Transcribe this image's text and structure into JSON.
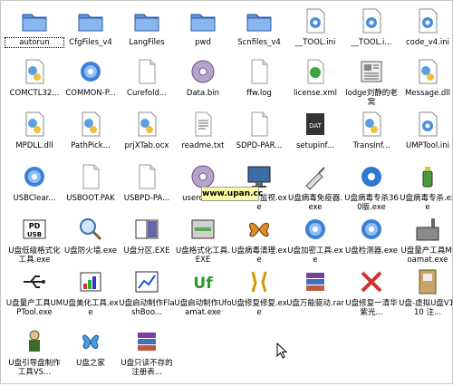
{
  "watermark": "www.upan.cc",
  "files": [
    {
      "label": "autorun",
      "icon": "folder-icon"
    },
    {
      "label": "CfgFiles_v4",
      "icon": "folder-icon"
    },
    {
      "label": "LangFiles",
      "icon": "folder-icon"
    },
    {
      "label": "pwd",
      "icon": "folder-icon"
    },
    {
      "label": "Scnfiles_v4",
      "icon": "folder-icon"
    },
    {
      "label": "__TOOL.ini",
      "icon": "settings-file-icon"
    },
    {
      "label": "__TOOL.i...",
      "icon": "settings-file-icon"
    },
    {
      "label": "code_v4.ini",
      "icon": "settings-file-icon"
    },
    {
      "label": "COMCTL32...",
      "icon": "dll-gear-icon"
    },
    {
      "label": "COMMON-P...",
      "icon": "gear-blue-icon"
    },
    {
      "label": "Curefold...",
      "icon": "document-icon"
    },
    {
      "label": "Data.bin",
      "icon": "disc-icon"
    },
    {
      "label": "ffw.log",
      "icon": "document-icon"
    },
    {
      "label": "license.xml",
      "icon": "xml-icon"
    },
    {
      "label": "lodge刘静的老窝",
      "icon": "newspaper-icon"
    },
    {
      "label": "Message.dll",
      "icon": "dll-gear-icon"
    },
    {
      "label": "MPDLL.dll",
      "icon": "dll-gear-icon"
    },
    {
      "label": "PathPick...",
      "icon": "dll-gear-icon"
    },
    {
      "label": "prjXTab.ocx",
      "icon": "dll-gear-icon"
    },
    {
      "label": "readme.txt",
      "icon": "text-file-icon"
    },
    {
      "label": "SDPD-PAR...",
      "icon": "document-icon"
    },
    {
      "label": "setupinf...",
      "icon": "dat-icon"
    },
    {
      "label": "TransInf...",
      "icon": "dll-gear-icon"
    },
    {
      "label": "UMPTool.ini",
      "icon": "settings-file-icon"
    },
    {
      "label": "USBClear...",
      "icon": "gear-blue-icon"
    },
    {
      "label": "USBOOT.PAK",
      "icon": "document-icon"
    },
    {
      "label": "USBPD-PA...",
      "icon": "document-icon"
    },
    {
      "label": "userdata...",
      "icon": "disc-icon"
    },
    {
      "label": "U盘病毒监视.exe",
      "icon": "monitor-icon"
    },
    {
      "label": "U盘病毒免疫器.exe",
      "icon": "syringe-icon"
    },
    {
      "label": "U盘病毒专杀360版.exe",
      "icon": "shield-gear-icon"
    },
    {
      "label": "U盘病毒专杀.exe",
      "icon": "bottle-icon"
    },
    {
      "label": "U盘低级格式化工具.exe",
      "icon": "usb-pd-icon"
    },
    {
      "label": "U盘防火墙.exe",
      "icon": "magnifier-icon"
    },
    {
      "label": "U盘分区.EXE",
      "icon": "partition-icon"
    },
    {
      "label": "U盘格式化工具.EXE",
      "icon": "format-tool-icon"
    },
    {
      "label": "U盘病毒清理.exe",
      "icon": "butterfly-icon"
    },
    {
      "label": "U盘加密工具.exe",
      "icon": "gear-blue-icon"
    },
    {
      "label": "U盘检测器.exe",
      "icon": "gear-blue-icon"
    },
    {
      "label": "U盘量产工具Mfoamat.exe",
      "icon": "factory-icon"
    },
    {
      "label": "U盘量产工具UMPTool.exe",
      "icon": "usb-symbol-icon"
    },
    {
      "label": "U盘美化工具.exe",
      "icon": "paint-icon"
    },
    {
      "label": "U盘启动制作FlashBoo...",
      "icon": "chart-window-icon"
    },
    {
      "label": "U盘启动制作Ufoamat.exe",
      "icon": "uf-logo-icon"
    },
    {
      "label": "U盘修复修复.exe",
      "icon": "tools-icon"
    },
    {
      "label": "U盘万能驱动.rar",
      "icon": "winrar-icon"
    },
    {
      "label": "U盘修复一清华紫光...",
      "icon": "repair-x-icon"
    },
    {
      "label": "U盘-虚拟U盘V1.10 注...",
      "icon": "virtual-disk-icon"
    },
    {
      "label": "U盘引导盘制作工具VS...",
      "icon": "boot-man-icon"
    },
    {
      "label": "U盘之家",
      "icon": "msn-butterfly-icon"
    },
    {
      "label": "U盘只读不存的注册表...",
      "icon": "winrar-icon"
    }
  ]
}
